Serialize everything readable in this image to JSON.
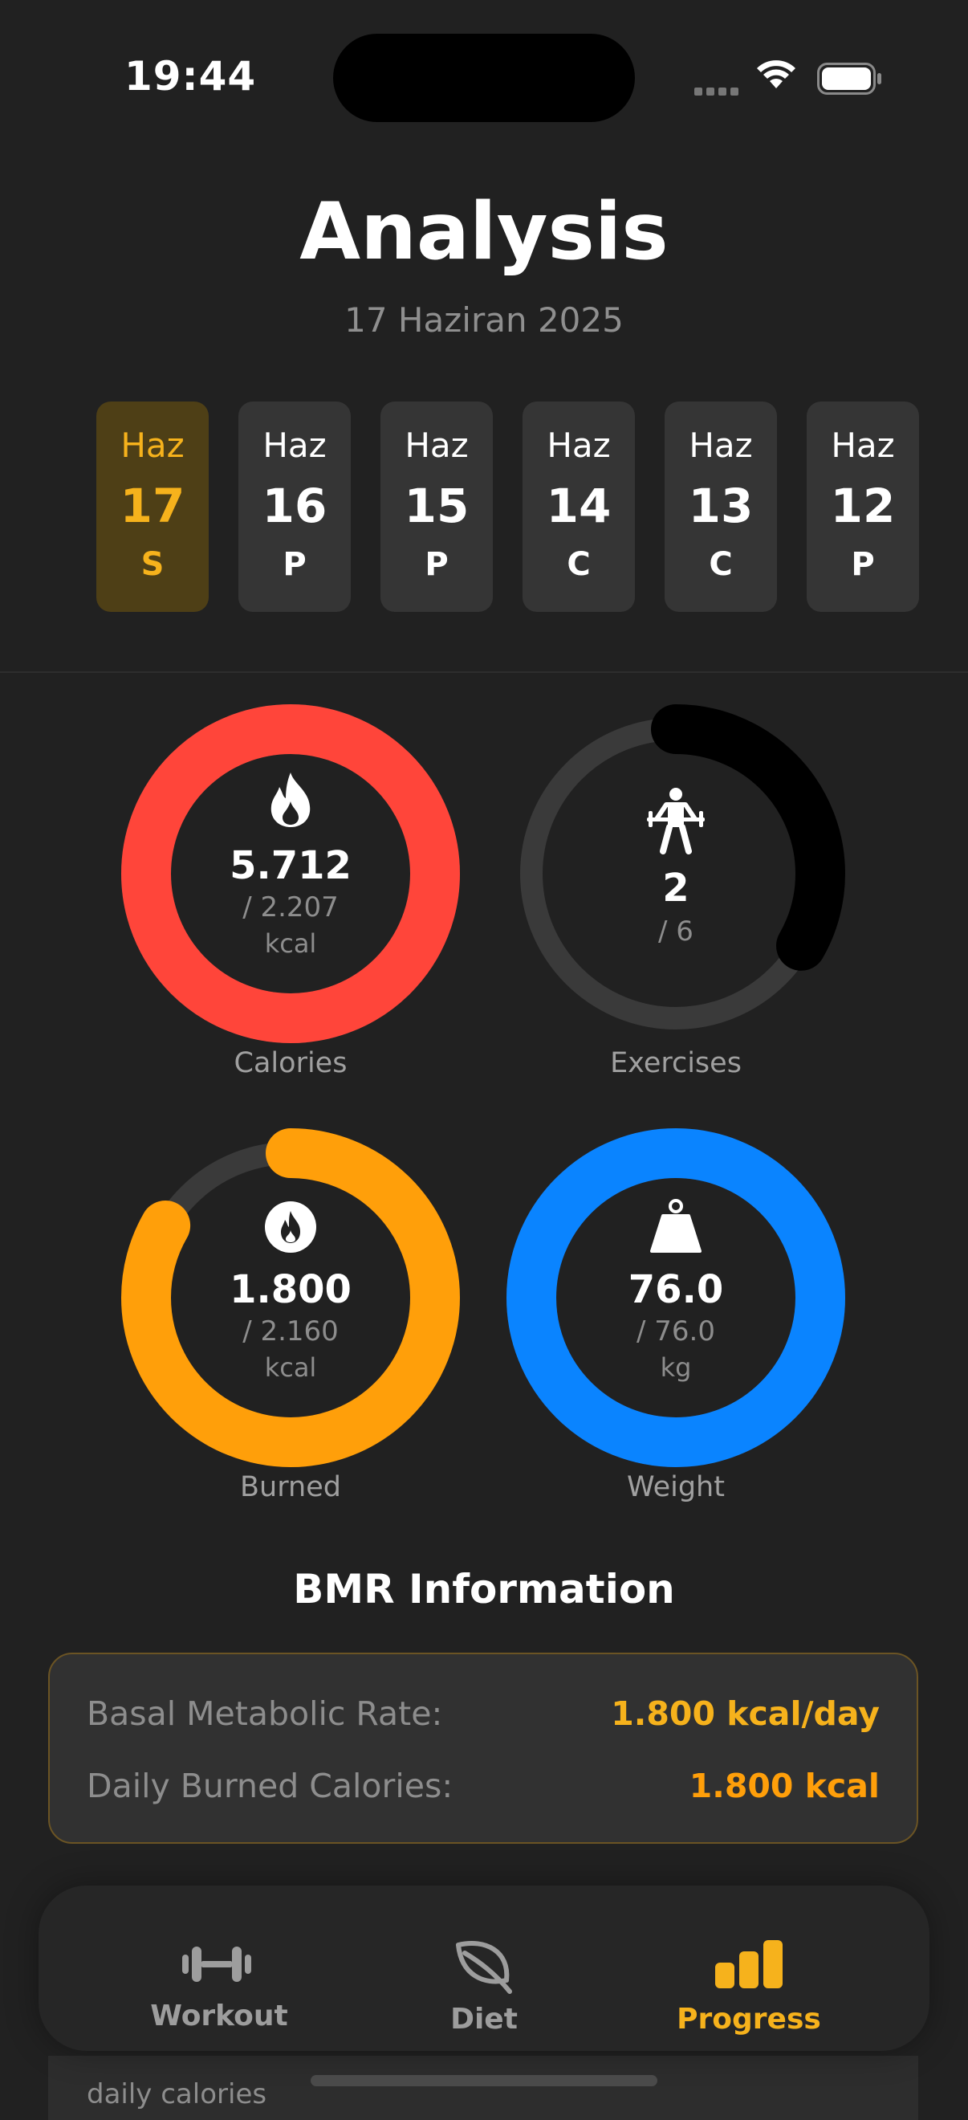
{
  "status_bar": {
    "time": "19:44"
  },
  "header": {
    "title": "Analysis",
    "subtitle": "17 Haziran 2025"
  },
  "date_strip": [
    {
      "month": "Haz",
      "day": "17",
      "weekday": "S",
      "selected": true
    },
    {
      "month": "Haz",
      "day": "16",
      "weekday": "P",
      "selected": false
    },
    {
      "month": "Haz",
      "day": "15",
      "weekday": "P",
      "selected": false
    },
    {
      "month": "Haz",
      "day": "14",
      "weekday": "C",
      "selected": false
    },
    {
      "month": "Haz",
      "day": "13",
      "weekday": "C",
      "selected": false
    },
    {
      "month": "Haz",
      "day": "12",
      "weekday": "P",
      "selected": false
    }
  ],
  "rings": {
    "calories": {
      "icon": "flame-icon",
      "value": "5.712",
      "target": "/ 2.207",
      "unit": "kcal",
      "label": "Calories",
      "progress": 1.0,
      "color": "#ff453a",
      "track": "#3a3a3a"
    },
    "exercises": {
      "icon": "weightlifter-icon",
      "value": "2",
      "target": "/ 6",
      "label": "Exercises",
      "progress": 0.333,
      "color": "#000000",
      "track": "#3a3a3a"
    },
    "burned": {
      "icon": "flame-circle-icon",
      "value": "1.800",
      "target": "/ 2.160",
      "unit": "kcal",
      "label": "Burned",
      "progress": 0.833,
      "color": "#ff9f0a",
      "track": "#3a3a3a"
    },
    "weight": {
      "icon": "weight-icon",
      "value": "76.0",
      "target": "/ 76.0",
      "unit": "kg",
      "label": "Weight",
      "progress": 1.0,
      "color": "#0a84ff",
      "track": "#3a3a3a"
    }
  },
  "bmr": {
    "title": "BMR Information",
    "rows": [
      {
        "label": "Basal Metabolic Rate:",
        "value": "1.800 kcal/day",
        "color": "#f6b21c"
      },
      {
        "label": "Daily Burned Calories:",
        "value": "1.800 kcal",
        "color": "#ff9f0a"
      }
    ]
  },
  "below_fold_text": "daily calories",
  "tab_bar": {
    "tabs": [
      {
        "label": "Workout",
        "icon": "dumbbell-icon",
        "active": false
      },
      {
        "label": "Diet",
        "icon": "leaf-icon",
        "active": false
      },
      {
        "label": "Progress",
        "icon": "bar-chart-icon",
        "active": true
      }
    ],
    "active_color": "#f6b21c",
    "inactive_color": "#9d9d9d"
  }
}
